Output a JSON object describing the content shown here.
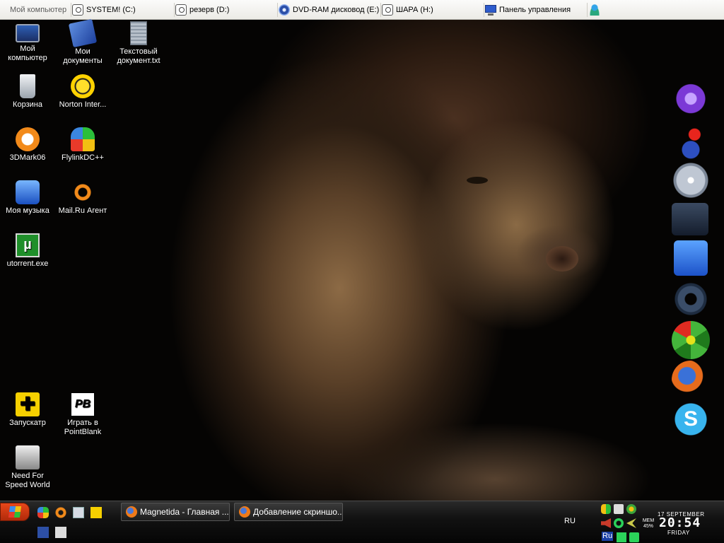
{
  "topbar": {
    "my_computer": "Мой компьютер",
    "drive_c": "SYSTEM! (C:)",
    "drive_d": "резерв (D:)",
    "drive_e": "DVD-RAM дисковод (E:)",
    "drive_h": "ШАРА (H:)",
    "control_panel": "Панель управления"
  },
  "desktop_icons": {
    "my_computer": "Мой компьютер",
    "my_documents": "Мои документы",
    "text_document": "Текстовый документ.txt",
    "recycle_bin": "Корзина",
    "norton": "Norton Inter...",
    "mark06": "3DMark06",
    "flylink": "FlylinkDC++",
    "my_music": "Моя музыка",
    "mailru": "Mail.Ru Агент",
    "utorrent": "utorrent.exe",
    "zapuskatr": "Запускатр",
    "pointblank": "Играть в PointBlank",
    "nfs": "Need For Speed World"
  },
  "taskbar": {
    "task1": "Magnetida - Главная ...",
    "task2": "Добавление скриншо...",
    "lang": "RU",
    "tray_lang": "Ru",
    "mem_label": "MEM",
    "mem_value": "45%",
    "date": "17 SEPTEMBER",
    "time": "20:54",
    "day": "FRIDAY"
  },
  "icons": {
    "start": "windows-flag-icon",
    "browser": "firefox-icon"
  },
  "colors": {
    "start_button": "#d9401a",
    "taskbar": "#121212",
    "topbar": "#f0efea"
  }
}
